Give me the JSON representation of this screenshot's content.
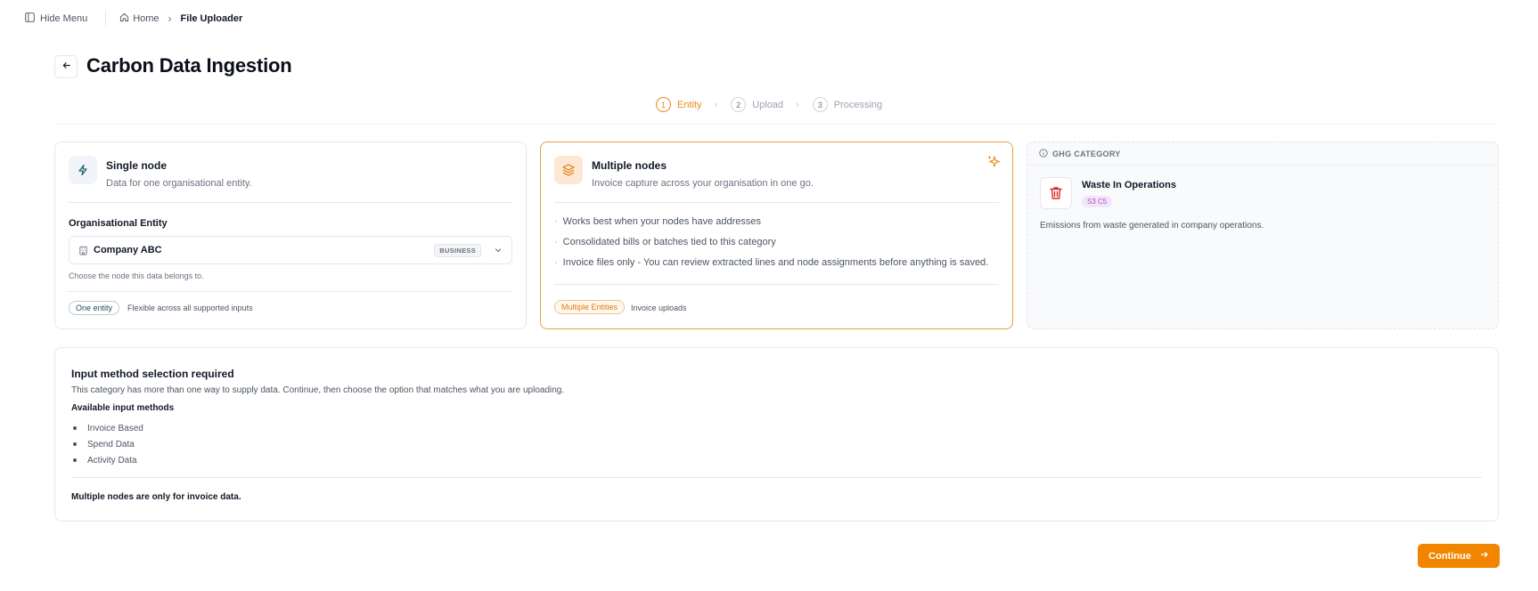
{
  "topbar": {
    "hide_menu_label": "Hide Menu",
    "breadcrumb": {
      "home": "Home",
      "current": "File Uploader"
    }
  },
  "page": {
    "title": "Carbon Data Ingestion"
  },
  "stepper": {
    "steps": [
      {
        "num": "1",
        "label": "Entity",
        "active": true
      },
      {
        "num": "2",
        "label": "Upload",
        "active": false
      },
      {
        "num": "3",
        "label": "Processing",
        "active": false
      }
    ]
  },
  "single_node": {
    "title": "Single node",
    "subtitle": "Data for one organisational entity.",
    "org_label": "Organisational Entity",
    "org_value": "Company ABC",
    "org_badge": "BUSINESS",
    "org_help": "Choose the node this data belongs to.",
    "pill": "One entity",
    "pill_note": "Flexible across all supported inputs"
  },
  "multiple_nodes": {
    "title": "Multiple nodes",
    "subtitle": "Invoice capture across your organisation in one go.",
    "bullets": [
      "Works best when your nodes have addresses",
      "Consolidated bills or batches tied to this category",
      "Invoice files only - You can review extracted lines and node assignments before anything is saved."
    ],
    "pill": "Multiple Entities",
    "pill_note": "Invoice uploads"
  },
  "ghg": {
    "header": "GHG CATEGORY",
    "title": "Waste In Operations",
    "code": "S3 C5",
    "description": "Emissions from waste generated in company operations."
  },
  "info": {
    "title": "Input method selection required",
    "description": "This category has more than one way to supply data. Continue, then choose the option that matches what you are uploading.",
    "subtitle": "Available input methods",
    "methods": [
      "Invoice Based",
      "Spend Data",
      "Activity Data"
    ],
    "footer": "Multiple nodes are only for invoice data."
  },
  "actions": {
    "continue_label": "Continue"
  },
  "colors": {
    "accent": "#f28500",
    "accent_text": "#ea8a1a",
    "ghg_code": "#a855c7",
    "trash": "#dc2626"
  }
}
